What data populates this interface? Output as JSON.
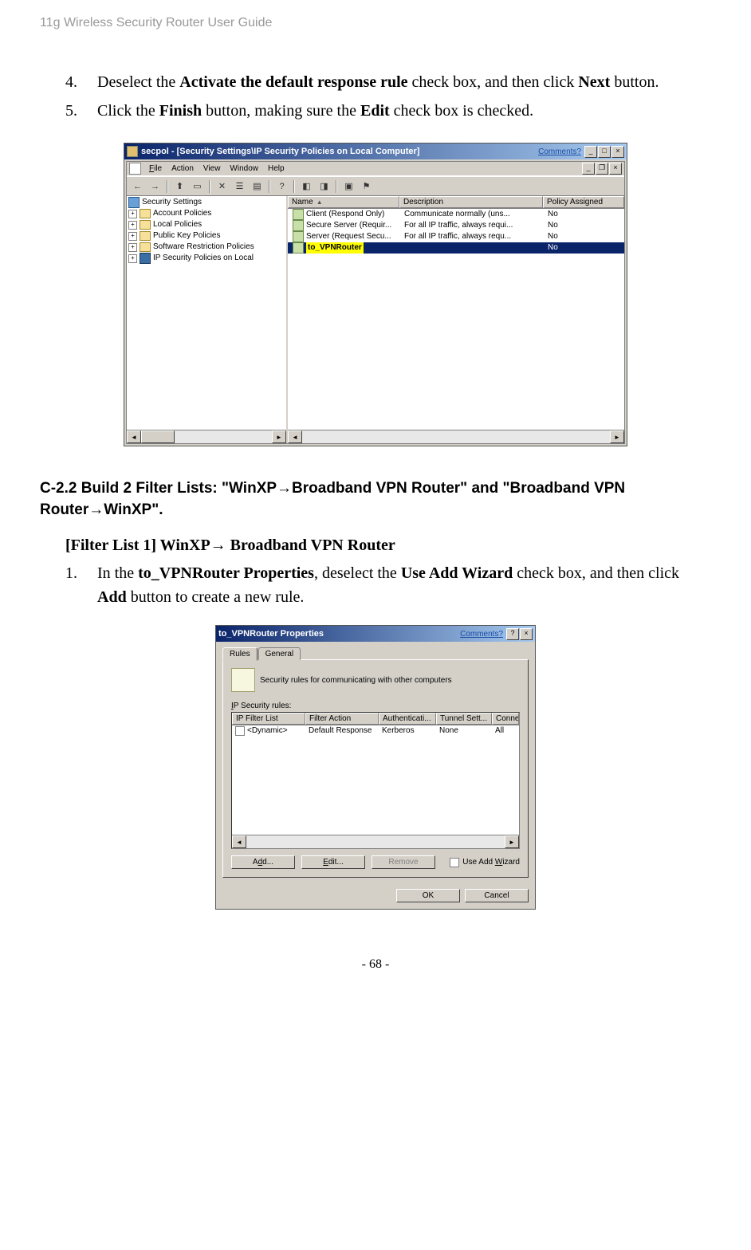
{
  "header": "11g Wireless Security Router User Guide",
  "footer": "- 68 -",
  "step4": {
    "num": "4.",
    "pre": "Deselect the ",
    "bold1": "Activate the default response rule",
    "mid": " check box, and then click ",
    "bold2": "Next",
    "post": " button."
  },
  "step5": {
    "num": "5.",
    "pre": "Click the ",
    "bold1": "Finish",
    "mid": " button, making sure the ",
    "bold2": "Edit",
    "post": " check box is checked."
  },
  "section_heading": "C-2.2 Build 2 Filter Lists: \"WinXP→Broadband VPN Router\" and \"Broadband VPN Router→WinXP\".",
  "filter1_heading": "[Filter List 1]  WinXP→ Broadband VPN Router",
  "step1b": {
    "num": "1.",
    "pre": "In the ",
    "bold1": "to_VPNRouter Properties",
    "mid1": ", deselect the ",
    "bold2": "Use Add Wizard",
    "mid2": " check box, and then click ",
    "bold3": "Add",
    "post": " button to create a new rule."
  },
  "secpol": {
    "title": "secpol - [Security Settings\\IP Security Policies on Local Computer]",
    "comments": "Comments?",
    "menus": {
      "file": "File",
      "action": "Action",
      "view": "View",
      "window": "Window",
      "help": "Help"
    },
    "tree": {
      "root": "Security Settings",
      "items": [
        "Account Policies",
        "Local Policies",
        "Public Key Policies",
        "Software Restriction Policies",
        "IP Security Policies on Local"
      ]
    },
    "columns": {
      "name": "Name",
      "desc": "Description",
      "policy": "Policy Assigned"
    },
    "rows": [
      {
        "name": "Client (Respond Only)",
        "desc": "Communicate normally (uns...",
        "pol": "No"
      },
      {
        "name": "Secure Server (Requir...",
        "desc": "For all IP traffic, always requi...",
        "pol": "No"
      },
      {
        "name": "Server (Request Secu...",
        "desc": "For all IP traffic, always requ...",
        "pol": "No"
      },
      {
        "name": "to_VPNRouter",
        "desc": "",
        "pol": "No"
      }
    ]
  },
  "props": {
    "title": "to_VPNRouter Properties",
    "comments": "Comments?",
    "tabs": {
      "rules": "Rules",
      "general": "General"
    },
    "info": "Security rules for communicating with other computers",
    "group_label": "IP Security rules:",
    "columns": {
      "c1": "IP Filter List",
      "c2": "Filter Action",
      "c3": "Authenticati...",
      "c4": "Tunnel Sett...",
      "c5": "Conne"
    },
    "row": {
      "c1": "<Dynamic>",
      "c2": "Default Response",
      "c3": "Kerberos",
      "c4": "None",
      "c5": "All"
    },
    "buttons": {
      "add": "Add...",
      "edit": "Edit...",
      "remove": "Remove",
      "wizard": "Use Add Wizard",
      "ok": "OK",
      "cancel": "Cancel"
    }
  }
}
